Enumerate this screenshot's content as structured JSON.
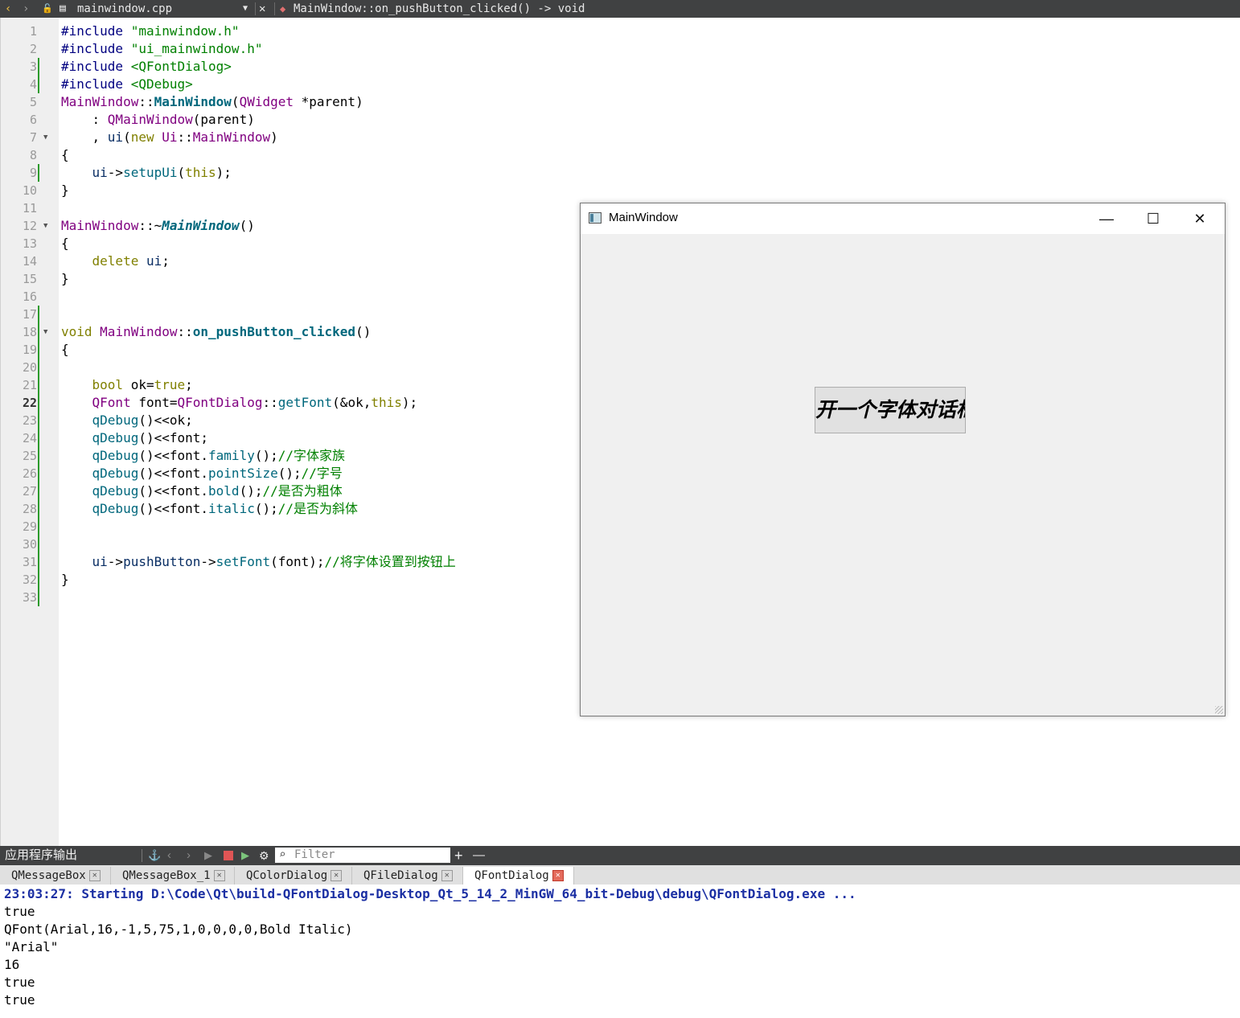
{
  "editor_toolbar": {
    "back_icon": "chevron-left",
    "forward_icon": "chevron-right",
    "file_name": "mainwindow.cpp",
    "close_icon": "close",
    "symbol": "MainWindow::on_pushButton_clicked() -> void"
  },
  "code": {
    "lines": [
      {
        "n": "1",
        "segments": [
          {
            "c": "pp",
            "t": "#include "
          },
          {
            "c": "str",
            "t": "\"mainwindow.h\""
          }
        ]
      },
      {
        "n": "2",
        "segments": [
          {
            "c": "pp",
            "t": "#include "
          },
          {
            "c": "str",
            "t": "\"ui_mainwindow.h\""
          }
        ]
      },
      {
        "n": "3",
        "segments": [
          {
            "c": "pp",
            "t": "#include "
          },
          {
            "c": "str",
            "t": "<QFontDialog>"
          }
        ]
      },
      {
        "n": "4",
        "segments": [
          {
            "c": "pp",
            "t": "#include "
          },
          {
            "c": "str",
            "t": "<QDebug>"
          }
        ]
      },
      {
        "n": "5",
        "segments": [
          {
            "c": "cls",
            "t": "MainWindow"
          },
          {
            "c": "",
            "t": "::"
          },
          {
            "c": "fnb",
            "t": "MainWindow"
          },
          {
            "c": "",
            "t": "("
          },
          {
            "c": "cls",
            "t": "QWidget"
          },
          {
            "c": "",
            "t": " *parent)"
          }
        ]
      },
      {
        "n": "6",
        "segments": [
          {
            "c": "",
            "t": "    : "
          },
          {
            "c": "cls",
            "t": "QMainWindow"
          },
          {
            "c": "",
            "t": "(parent)"
          }
        ]
      },
      {
        "n": "7",
        "segments": [
          {
            "c": "",
            "t": "    , "
          },
          {
            "c": "var",
            "t": "ui"
          },
          {
            "c": "",
            "t": "("
          },
          {
            "c": "kw",
            "t": "new"
          },
          {
            "c": "",
            "t": " "
          },
          {
            "c": "cls",
            "t": "Ui"
          },
          {
            "c": "",
            "t": "::"
          },
          {
            "c": "cls",
            "t": "MainWindow"
          },
          {
            "c": "",
            "t": ")"
          }
        ]
      },
      {
        "n": "8",
        "segments": [
          {
            "c": "",
            "t": "{"
          }
        ]
      },
      {
        "n": "9",
        "segments": [
          {
            "c": "",
            "t": "    "
          },
          {
            "c": "var",
            "t": "ui"
          },
          {
            "c": "",
            "t": "->"
          },
          {
            "c": "fn",
            "t": "setupUi"
          },
          {
            "c": "",
            "t": "("
          },
          {
            "c": "kw",
            "t": "this"
          },
          {
            "c": "",
            "t": ");"
          }
        ]
      },
      {
        "n": "10",
        "segments": [
          {
            "c": "",
            "t": "}"
          }
        ]
      },
      {
        "n": "11",
        "segments": []
      },
      {
        "n": "12",
        "segments": [
          {
            "c": "cls",
            "t": "MainWindow"
          },
          {
            "c": "",
            "t": "::~"
          },
          {
            "c": "fni",
            "t": "MainWindow"
          },
          {
            "c": "",
            "t": "()"
          }
        ]
      },
      {
        "n": "13",
        "segments": [
          {
            "c": "",
            "t": "{"
          }
        ]
      },
      {
        "n": "14",
        "segments": [
          {
            "c": "",
            "t": "    "
          },
          {
            "c": "kw",
            "t": "delete"
          },
          {
            "c": "",
            "t": " "
          },
          {
            "c": "var",
            "t": "ui"
          },
          {
            "c": "",
            "t": ";"
          }
        ]
      },
      {
        "n": "15",
        "segments": [
          {
            "c": "",
            "t": "}"
          }
        ]
      },
      {
        "n": "16",
        "segments": []
      },
      {
        "n": "17",
        "segments": []
      },
      {
        "n": "18",
        "segments": [
          {
            "c": "kw",
            "t": "void"
          },
          {
            "c": "",
            "t": " "
          },
          {
            "c": "cls",
            "t": "MainWindow"
          },
          {
            "c": "",
            "t": "::"
          },
          {
            "c": "fnb",
            "t": "on_pushButton_clicked"
          },
          {
            "c": "",
            "t": "()"
          }
        ]
      },
      {
        "n": "19",
        "segments": [
          {
            "c": "",
            "t": "{"
          }
        ]
      },
      {
        "n": "20",
        "segments": []
      },
      {
        "n": "21",
        "segments": [
          {
            "c": "",
            "t": "    "
          },
          {
            "c": "kw",
            "t": "bool"
          },
          {
            "c": "",
            "t": " ok="
          },
          {
            "c": "kw",
            "t": "true"
          },
          {
            "c": "",
            "t": ";"
          }
        ]
      },
      {
        "n": "22",
        "segments": [
          {
            "c": "",
            "t": "    "
          },
          {
            "c": "cls",
            "t": "QFont"
          },
          {
            "c": "",
            "t": " font="
          },
          {
            "c": "cls",
            "t": "QFontDialog"
          },
          {
            "c": "",
            "t": "::"
          },
          {
            "c": "fn",
            "t": "getFont"
          },
          {
            "c": "",
            "t": "(&ok,"
          },
          {
            "c": "kw",
            "t": "this"
          },
          {
            "c": "",
            "t": ");"
          }
        ]
      },
      {
        "n": "23",
        "segments": [
          {
            "c": "",
            "t": "    "
          },
          {
            "c": "fn",
            "t": "qDebug"
          },
          {
            "c": "",
            "t": "()<<ok;"
          }
        ]
      },
      {
        "n": "24",
        "segments": [
          {
            "c": "",
            "t": "    "
          },
          {
            "c": "fn",
            "t": "qDebug"
          },
          {
            "c": "",
            "t": "()<<font;"
          }
        ]
      },
      {
        "n": "25",
        "segments": [
          {
            "c": "",
            "t": "    "
          },
          {
            "c": "fn",
            "t": "qDebug"
          },
          {
            "c": "",
            "t": "()<<font."
          },
          {
            "c": "fn",
            "t": "family"
          },
          {
            "c": "",
            "t": "();"
          },
          {
            "c": "cm",
            "t": "//字体家族"
          }
        ]
      },
      {
        "n": "26",
        "segments": [
          {
            "c": "",
            "t": "    "
          },
          {
            "c": "fn",
            "t": "qDebug"
          },
          {
            "c": "",
            "t": "()<<font."
          },
          {
            "c": "fn",
            "t": "pointSize"
          },
          {
            "c": "",
            "t": "();"
          },
          {
            "c": "cm",
            "t": "//字号"
          }
        ]
      },
      {
        "n": "27",
        "segments": [
          {
            "c": "",
            "t": "    "
          },
          {
            "c": "fn",
            "t": "qDebug"
          },
          {
            "c": "",
            "t": "()<<font."
          },
          {
            "c": "fn",
            "t": "bold"
          },
          {
            "c": "",
            "t": "();"
          },
          {
            "c": "cm",
            "t": "//是否为粗体"
          }
        ]
      },
      {
        "n": "28",
        "segments": [
          {
            "c": "",
            "t": "    "
          },
          {
            "c": "fn",
            "t": "qDebug"
          },
          {
            "c": "",
            "t": "()<<font."
          },
          {
            "c": "fn",
            "t": "italic"
          },
          {
            "c": "",
            "t": "();"
          },
          {
            "c": "cm",
            "t": "//是否为斜体"
          }
        ]
      },
      {
        "n": "29",
        "segments": []
      },
      {
        "n": "30",
        "segments": []
      },
      {
        "n": "31",
        "segments": [
          {
            "c": "",
            "t": "    "
          },
          {
            "c": "var",
            "t": "ui"
          },
          {
            "c": "",
            "t": "->"
          },
          {
            "c": "var",
            "t": "pushButton"
          },
          {
            "c": "",
            "t": "->"
          },
          {
            "c": "fn",
            "t": "setFont"
          },
          {
            "c": "",
            "t": "(font);"
          },
          {
            "c": "cm",
            "t": "//将字体设置到按钮上"
          }
        ]
      },
      {
        "n": "32",
        "segments": [
          {
            "c": "",
            "t": "}"
          }
        ]
      },
      {
        "n": "33",
        "segments": []
      }
    ],
    "current_line": "22",
    "fold_markers": [
      "7",
      "12",
      "18"
    ],
    "changed_lines": [
      "3",
      "4",
      "9",
      "17",
      "18",
      "19",
      "20",
      "21",
      "22",
      "23",
      "24",
      "25",
      "26",
      "27",
      "28",
      "29",
      "30",
      "31",
      "32",
      "33"
    ]
  },
  "main_window": {
    "title": "MainWindow",
    "minimize_glyph": "—",
    "maximize_glyph": "☐",
    "close_glyph": "✕",
    "button_label": "开一个字体对话框"
  },
  "output_pane": {
    "title": "应用程序输出",
    "filter_placeholder": "Filter",
    "add_glyph": "+",
    "remove_glyph": "—",
    "tabs": [
      {
        "label": "QMessageBox",
        "active": false
      },
      {
        "label": "QMessageBox_1",
        "active": false
      },
      {
        "label": "QColorDialog",
        "active": false
      },
      {
        "label": "QFileDialog",
        "active": false
      },
      {
        "label": "QFontDialog",
        "active": true
      }
    ],
    "lines": [
      "23:03:27: Starting D:\\Code\\Qt\\build-QFontDialog-Desktop_Qt_5_14_2_MinGW_64_bit-Debug\\debug\\QFontDialog.exe ...",
      "true",
      "QFont(Arial,16,-1,5,75,1,0,0,0,0,Bold Italic)",
      "\"Arial\"",
      "16",
      "true",
      "true"
    ]
  },
  "colors": {
    "toolbar_bg": "#404142",
    "keyword": "#808000",
    "string": "#008000",
    "class": "#800080",
    "function": "#00677c",
    "change_bar": "#2c9b2c",
    "start_line": "#1b2fa3"
  }
}
